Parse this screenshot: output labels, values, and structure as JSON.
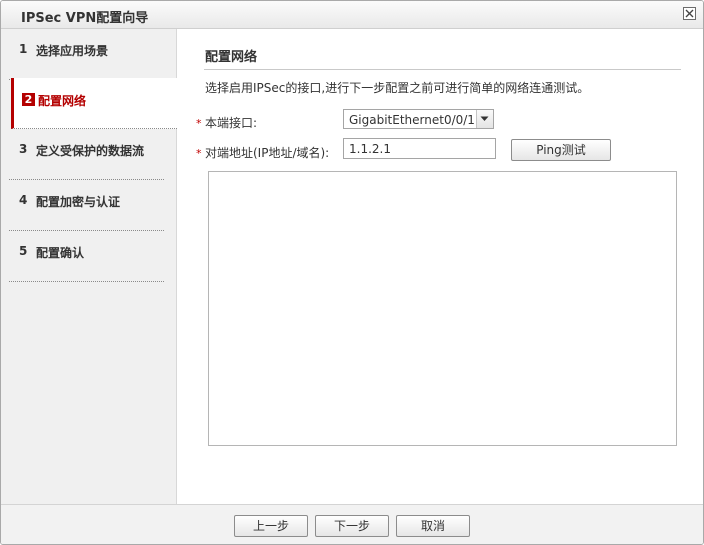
{
  "window": {
    "title": "IPSec VPN配置向导"
  },
  "sidebar": {
    "steps": [
      {
        "num": "1",
        "label": "选择应用场景",
        "active": false
      },
      {
        "num": "2",
        "label": "配置网络",
        "active": true
      },
      {
        "num": "3",
        "label": "定义受保护的数据流",
        "active": false
      },
      {
        "num": "4",
        "label": "配置加密与认证",
        "active": false
      },
      {
        "num": "5",
        "label": "配置确认",
        "active": false
      }
    ]
  },
  "main": {
    "heading": "配置网络",
    "description": "选择启用IPSec的接口,进行下一步配置之前可进行简单的网络连通测试。",
    "required_mark": "*",
    "local_interface": {
      "label": "本端接口:",
      "value": "GigabitEthernet0/0/1"
    },
    "peer_address": {
      "label": "对端地址(IP地址/域名):",
      "value": "1.1.2.1"
    },
    "ping_button": "Ping测试",
    "output": ""
  },
  "footer": {
    "prev": "上一步",
    "next": "下一步",
    "cancel": "取消"
  },
  "colors": {
    "accent": "#b40000",
    "required": "#c00000"
  }
}
